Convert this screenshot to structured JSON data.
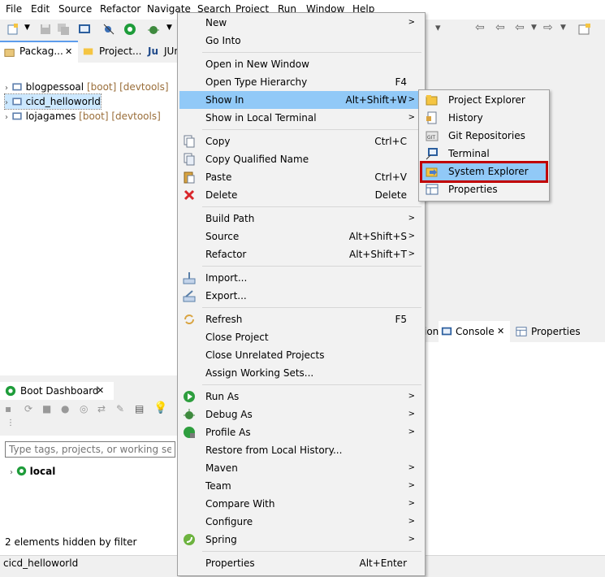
{
  "menubar": {
    "items": [
      "File",
      "Edit",
      "Source",
      "Refactor",
      "Navigate",
      "Search",
      "Project",
      "Run",
      "Window",
      "Help"
    ]
  },
  "tabs": {
    "package_explorer": "Packag...",
    "project_explorer": "Project...",
    "junit": "JUn"
  },
  "tree": {
    "rows": [
      {
        "name": "blogpessoal",
        "deco": "[boot] [devtools]"
      },
      {
        "name": "cicd_helloworld",
        "deco": "[boot] [devtools]"
      },
      {
        "name": "lojagames",
        "deco": "[boot] [devtools]"
      }
    ]
  },
  "boot": {
    "title": "Boot Dashboard",
    "filter_placeholder": "Type tags, projects, or working set nam",
    "local_label": "local",
    "hidden_text": "2 elements hidden by filter"
  },
  "status": {
    "text": "cicd_helloworld"
  },
  "right": {
    "tab_partial": "ion",
    "console": "Console",
    "properties": "Properties"
  },
  "context_menu": {
    "new": "New",
    "go_into": "Go Into",
    "open_new_window": "Open in New Window",
    "open_type_hierarchy": "Open Type Hierarchy",
    "open_type_hierarchy_sc": "F4",
    "show_in": "Show In",
    "show_in_sc": "Alt+Shift+W",
    "show_in_local_terminal": "Show in Local Terminal",
    "copy": "Copy",
    "copy_sc": "Ctrl+C",
    "copy_qualified": "Copy Qualified Name",
    "paste": "Paste",
    "paste_sc": "Ctrl+V",
    "delete": "Delete",
    "delete_sc": "Delete",
    "build_path": "Build Path",
    "source": "Source",
    "source_sc": "Alt+Shift+S",
    "refactor": "Refactor",
    "refactor_sc": "Alt+Shift+T",
    "import": "Import...",
    "export": "Export...",
    "refresh": "Refresh",
    "refresh_sc": "F5",
    "close_project": "Close Project",
    "close_unrelated": "Close Unrelated Projects",
    "assign_working_sets": "Assign Working Sets...",
    "run_as": "Run As",
    "debug_as": "Debug As",
    "profile_as": "Profile As",
    "restore_history": "Restore from Local History...",
    "maven": "Maven",
    "team": "Team",
    "compare_with": "Compare With",
    "configure": "Configure",
    "spring": "Spring",
    "properties": "Properties",
    "properties_sc": "Alt+Enter"
  },
  "submenu": {
    "project_explorer": "Project Explorer",
    "history": "History",
    "git_repositories": "Git Repositories",
    "terminal": "Terminal",
    "system_explorer": "System Explorer",
    "properties": "Properties"
  },
  "colors": {
    "highlight": "#91c9f7",
    "red_box": "#c00000",
    "decoration": "#9a6e3a"
  }
}
